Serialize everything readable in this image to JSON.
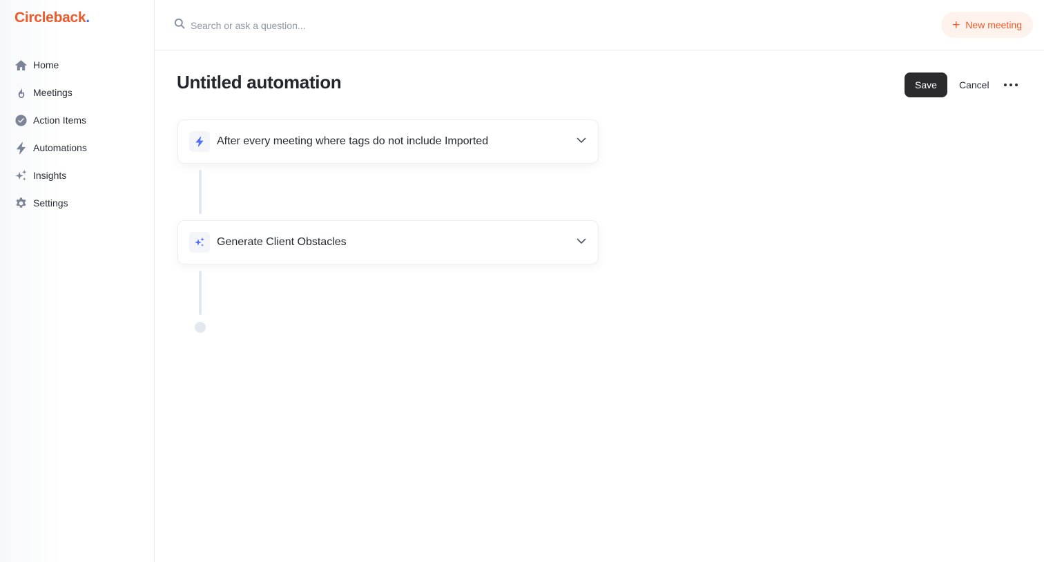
{
  "brand": {
    "name": "Circleback",
    "dot": "."
  },
  "sidebar": {
    "items": [
      {
        "label": "Home",
        "icon": "home-icon"
      },
      {
        "label": "Meetings",
        "icon": "flame-icon"
      },
      {
        "label": "Action Items",
        "icon": "check-circle-icon"
      },
      {
        "label": "Automations",
        "icon": "lightning-icon"
      },
      {
        "label": "Insights",
        "icon": "sparkles-icon"
      },
      {
        "label": "Settings",
        "icon": "gear-icon"
      }
    ]
  },
  "topbar": {
    "search_placeholder": "Search or ask a question...",
    "new_meeting_label": "New meeting"
  },
  "page": {
    "title": "Untitled automation",
    "save_label": "Save",
    "cancel_label": "Cancel"
  },
  "steps": [
    {
      "label": "After every meeting where tags do not include Imported",
      "icon": "lightning-icon"
    },
    {
      "label": "Generate Client Obstacles",
      "icon": "sparkles-icon"
    }
  ],
  "colors": {
    "brand": "#ef5a2a",
    "brand_dot": "#3b6cf6",
    "accent": "#4f6ef7",
    "save_button": "#2b2b2d"
  }
}
